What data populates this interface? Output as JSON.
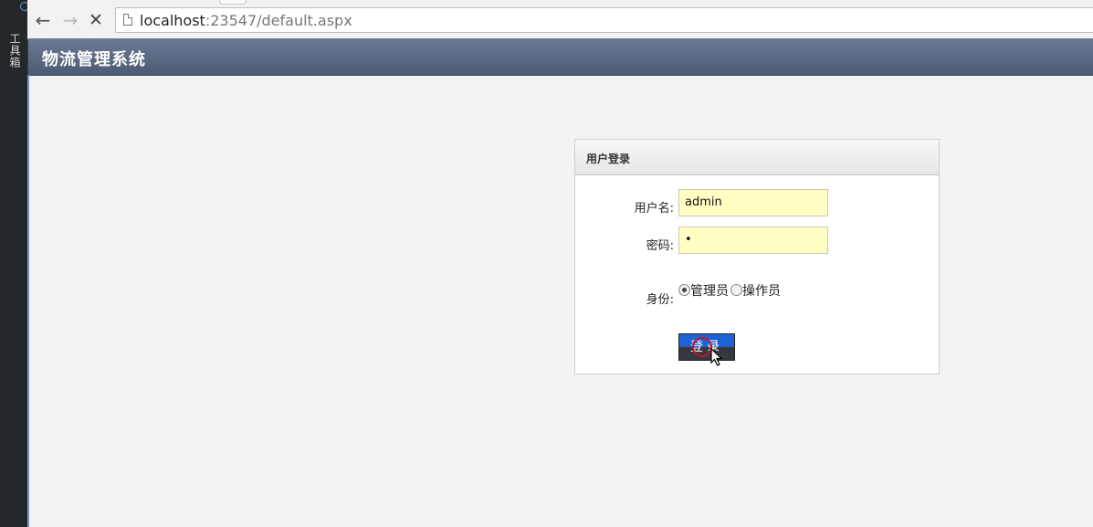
{
  "sidebar": {
    "tool_label": "工具箱"
  },
  "browser": {
    "url_host": "localhost",
    "url_rest": ":23547/default.aspx",
    "icons": {
      "back": "back-arrow-icon",
      "forward": "forward-arrow-icon",
      "stop": "stop-x-icon",
      "page": "page-icon"
    }
  },
  "app": {
    "title": "物流管理系统"
  },
  "login": {
    "title": "用户登录",
    "username_label": "用户名:",
    "username_value": "admin",
    "password_label": "密码:",
    "password_value": "•",
    "role_label": "身份:",
    "roles": [
      {
        "label": "管理员",
        "selected": true
      },
      {
        "label": "操作员",
        "selected": false
      }
    ],
    "submit_label": "登录"
  },
  "colors": {
    "header": "#5a6883",
    "field_bg": "#ffffc4",
    "button_top": "#1e63d6",
    "button_bottom": "#35383e"
  }
}
